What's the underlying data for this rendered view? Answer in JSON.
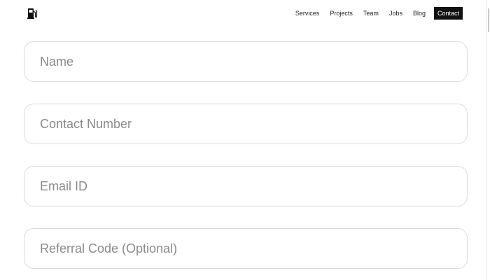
{
  "header": {
    "nav": [
      {
        "label": "Services"
      },
      {
        "label": "Projects"
      },
      {
        "label": "Team"
      },
      {
        "label": "Jobs"
      },
      {
        "label": "Blog"
      },
      {
        "label": "Contact",
        "active": true
      }
    ]
  },
  "form": {
    "name": {
      "placeholder": "Name",
      "value": ""
    },
    "contact_number": {
      "placeholder": "Contact Number",
      "value": ""
    },
    "email": {
      "placeholder": "Email ID",
      "value": ""
    },
    "referral_code": {
      "placeholder": "Referral Code (Optional)",
      "value": ""
    }
  },
  "icons": {
    "logo": "fuel-pump-icon"
  },
  "colors": {
    "active_nav_bg": "#111111",
    "active_nav_text": "#ffffff",
    "field_border": "#dcdcdc",
    "placeholder_text": "#8a8a8a"
  }
}
